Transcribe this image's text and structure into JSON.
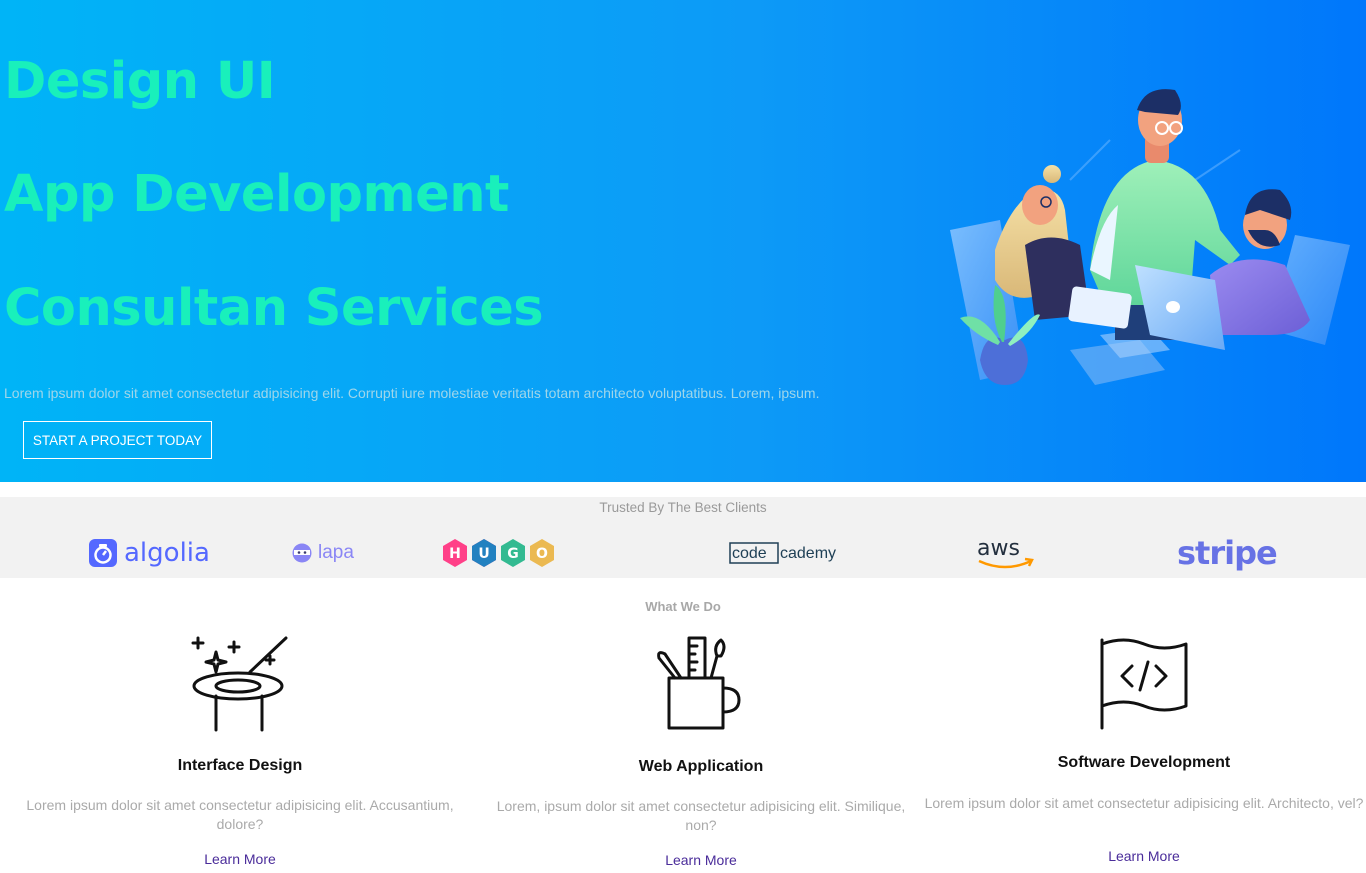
{
  "hero": {
    "headlines": [
      "Design UI",
      "App Development",
      "Consultan Services"
    ],
    "description": "Lorem ipsum dolor sit amet consectetur adipisicing elit. Corrupti iure molestiae veritatis totam architecto voluptatibus. Lorem, ipsum.",
    "cta_label": "START A PROJECT TODAY",
    "gradient_start": "#00b4f7",
    "gradient_end": "#0077fb",
    "headline_color": "#19f0bb"
  },
  "trusted": {
    "title": "Trusted By The Best Clients",
    "logos": [
      "algolia",
      "lapa",
      "HUGO",
      "codecademy",
      "aws",
      "stripe"
    ]
  },
  "what_we_do": {
    "title": "What We Do",
    "services": [
      {
        "icon": "magic-hat-icon",
        "title": "Interface Design",
        "text": "Lorem ipsum dolor sit amet consectetur adipisicing elit. Accusantium, dolore?",
        "link": "Learn More"
      },
      {
        "icon": "pencil-cup-icon",
        "title": "Web Application",
        "text": "Lorem, ipsum dolor sit amet consectetur adipisicing elit. Similique, non?",
        "link": "Learn More"
      },
      {
        "icon": "code-flag-icon",
        "title": "Software Development",
        "text": "Lorem ipsum dolor sit amet consectetur adipisicing elit. Architecto, vel?",
        "link": "Learn More"
      }
    ]
  }
}
